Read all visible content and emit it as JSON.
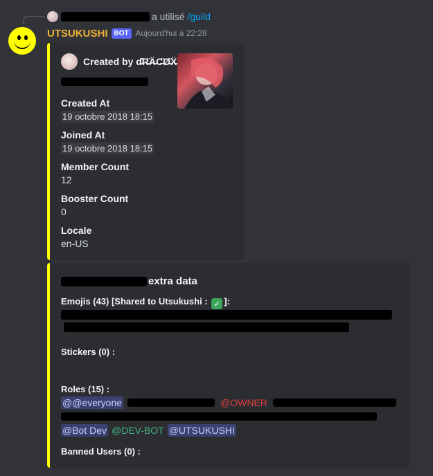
{
  "reply": {
    "used_text": "a utilisé",
    "command": "/guild"
  },
  "message": {
    "username": "UTSUKUSHI",
    "bot_badge": "BOT",
    "timestamp": "Aujourd'hui à 22:28"
  },
  "embed1": {
    "author": "Created by ɗ̶̈R̶̈Ä̶C̶̈Ø̶̈Ẍ̶",
    "fields": [
      {
        "name": "Created At",
        "value": "19 octobre 2018 18:15"
      },
      {
        "name": "Joined At",
        "value": "19 octobre 2018 18:15"
      },
      {
        "name": "Member Count",
        "value": "12"
      },
      {
        "name": "Booster Count",
        "value": "0"
      },
      {
        "name": "Locale",
        "value": "en-US"
      }
    ]
  },
  "embed2": {
    "title_suffix": "extra data",
    "emojis_label_start": "Emojis (43) [Shared to Utsukushi :",
    "emojis_label_end": "]:",
    "stickers_label": "Stickers (0) :",
    "roles_label": "Roles (15) :",
    "roles_visible": {
      "everyone": "@@everyone",
      "owner": "@OWNER",
      "bot_dev": "@Bot Dev",
      "dev_bot": "@DEV-BOT",
      "utsukushi": "@UTSUKUSHI"
    },
    "banned_label": "Banned Users (0) :"
  },
  "colors": {
    "embed_accent": "#ffff00",
    "username": "#f0b232",
    "bot_badge": "#5865f2",
    "command_link": "#00a8fc"
  },
  "icons": [
    "reply-user-avatar",
    "smiley-avatar",
    "author-avatar-icon",
    "server-thumbnail",
    "checkmark-emoji"
  ]
}
